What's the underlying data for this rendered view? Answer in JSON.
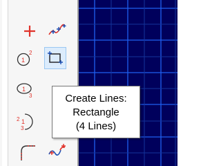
{
  "tooltip": {
    "line1": "Create Lines:",
    "line2": "Rectangle",
    "line3": "(4 Lines)"
  },
  "tools": [
    {
      "name": "create-point-icon",
      "selected": false
    },
    {
      "name": "create-spline-icon",
      "selected": false
    },
    {
      "name": "create-circle-icon",
      "selected": false
    },
    {
      "name": "create-rectangle-icon",
      "selected": true
    },
    {
      "name": "create-ellipse-icon",
      "selected": false
    },
    {
      "name": "create-arc-icon",
      "selected": false
    },
    {
      "name": "create-fillet-icon",
      "selected": false
    },
    {
      "name": "create-connected-spline-icon",
      "selected": false
    }
  ],
  "colors": {
    "tool_red": "#e0322a",
    "tool_blue": "#1c4fb4",
    "viewport_bg": "#00005c",
    "grid_line": "#1f5ff0"
  }
}
